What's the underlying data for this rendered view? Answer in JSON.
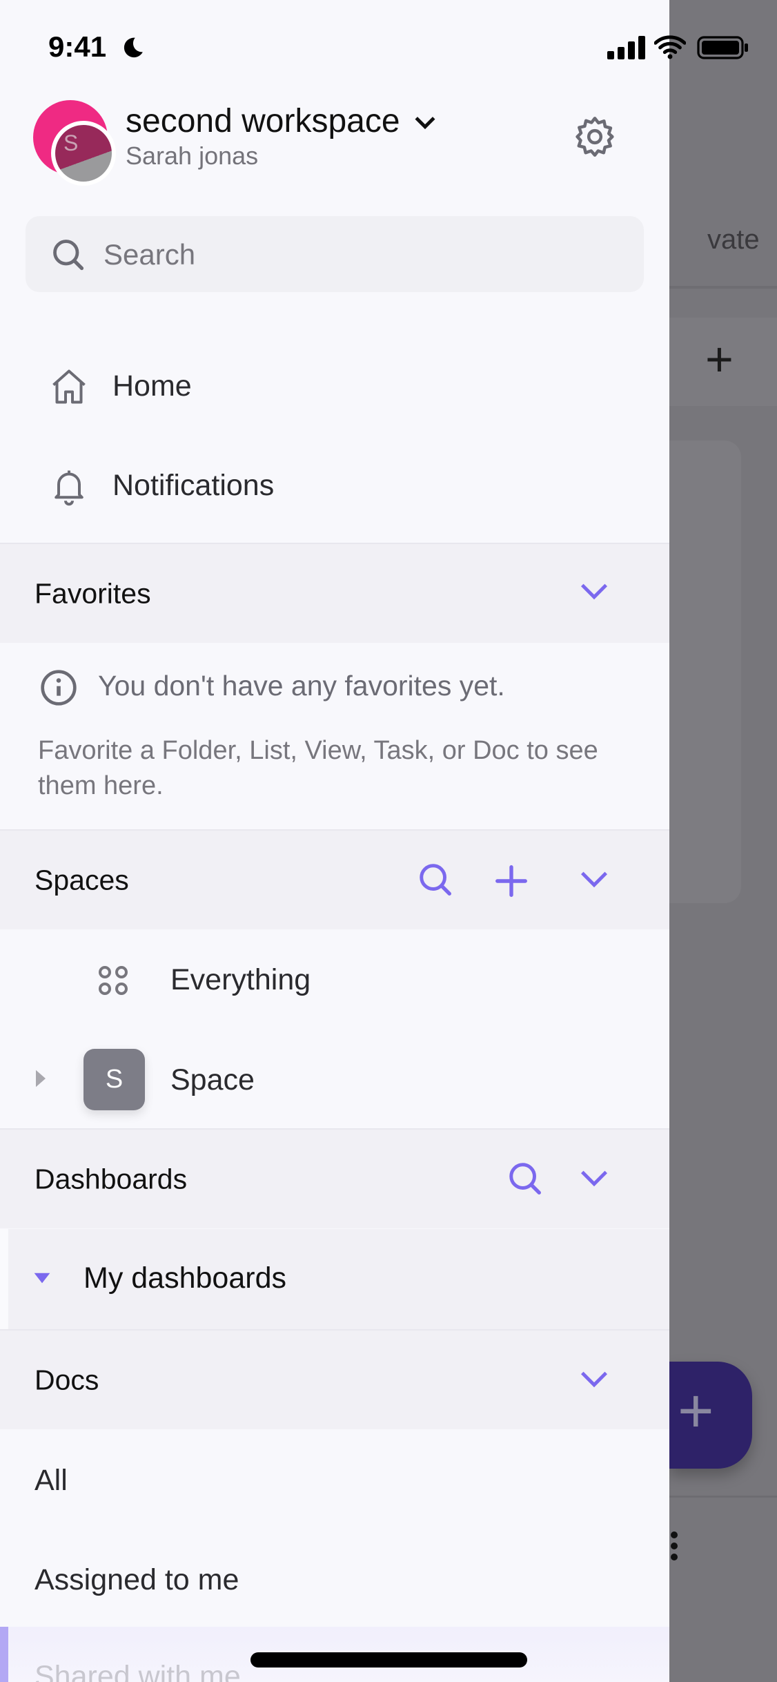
{
  "status_bar": {
    "time": "9:41"
  },
  "workspace": {
    "name": "second workspace",
    "user": "Sarah jonas",
    "avatar_letter": "S"
  },
  "search": {
    "placeholder": "Search"
  },
  "nav": [
    {
      "label": "Home",
      "icon": "home-icon"
    },
    {
      "label": "Notifications",
      "icon": "bell-icon"
    }
  ],
  "favorites": {
    "title": "Favorites",
    "empty_title": "You don't have any favorites yet.",
    "empty_desc": "Favorite a Folder, List, View, Task, or Doc to see them here."
  },
  "spaces": {
    "title": "Spaces",
    "items": [
      {
        "label": "Everything"
      },
      {
        "label": "Space",
        "letter": "S"
      }
    ]
  },
  "dashboards": {
    "title": "Dashboards",
    "items": [
      {
        "label": "My dashboards"
      }
    ]
  },
  "docs": {
    "title": "Docs",
    "items": [
      {
        "label": "All"
      },
      {
        "label": "Assigned to me"
      },
      {
        "label": "Shared with me"
      }
    ]
  },
  "background": {
    "tab_fragment": "vate"
  },
  "colors": {
    "accent": "#7b68ee",
    "overlay": "#77767b",
    "fab": "#2e2268"
  }
}
